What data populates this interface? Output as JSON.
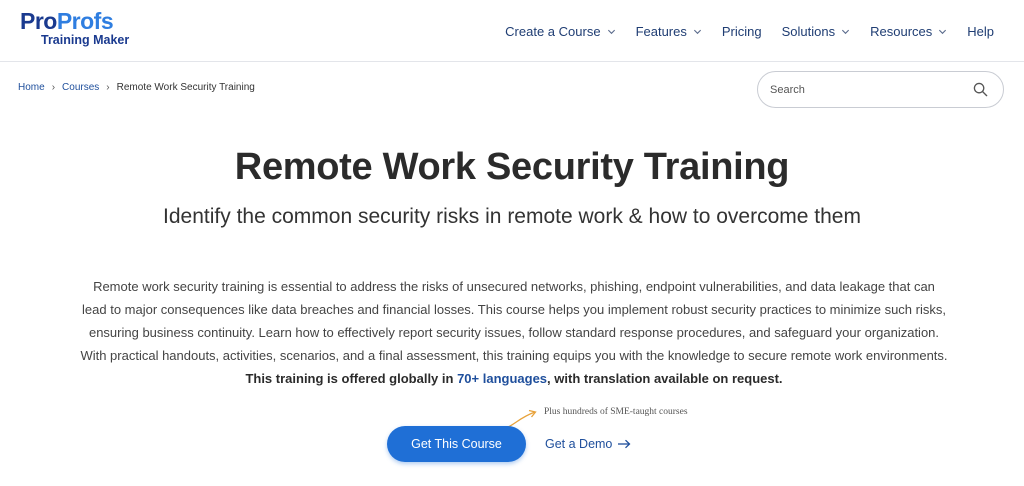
{
  "header": {
    "logo": {
      "brand_a": "Pro",
      "brand_b": "Profs",
      "product": "Training Maker"
    },
    "nav": [
      {
        "label": "Create a Course",
        "has_dropdown": true
      },
      {
        "label": "Features",
        "has_dropdown": true
      },
      {
        "label": "Pricing",
        "has_dropdown": false
      },
      {
        "label": "Solutions",
        "has_dropdown": true
      },
      {
        "label": "Resources",
        "has_dropdown": true
      },
      {
        "label": "Help",
        "has_dropdown": false
      }
    ]
  },
  "breadcrumb": {
    "home": "Home",
    "courses": "Courses",
    "current": "Remote Work Security Training",
    "separator": "›"
  },
  "search": {
    "placeholder": "Search",
    "value": ""
  },
  "main": {
    "title": "Remote Work Security Training",
    "subtitle": "Identify the common security risks in remote work & how to overcome them",
    "description": "Remote work security training is essential to address the risks of unsecured networks, phishing, endpoint vulnerabilities, and data leakage that can lead to major consequences like data breaches and financial losses. This course helps you implement robust security practices to minimize such risks, ensuring business continuity. Learn how to effectively report security issues, follow standard response procedures, and safeguard your organization. With practical handouts, activities, scenarios, and a final assessment, this training equips you with the knowledge to secure remote work environments.",
    "highlight_pre": "This training is offered globally in ",
    "highlight_link": "70+ languages",
    "highlight_post": ", with translation available on request."
  },
  "cta": {
    "note": "Plus hundreds of SME-taught courses",
    "primary_label": "Get This Course",
    "secondary_label": "Get a Demo"
  },
  "colors": {
    "primary": "#1f6fd6",
    "nav_text": "#1f3d73",
    "link": "#1f4f9c",
    "logo_dark": "#1a3a8f",
    "logo_light": "#2f7ee0",
    "accent_arrow": "#e8a23a"
  },
  "icons": {
    "search": "search-icon",
    "dropdown": "chevron-down-icon",
    "demo": "arrow-right-icon",
    "note": "curved-arrow-icon"
  }
}
